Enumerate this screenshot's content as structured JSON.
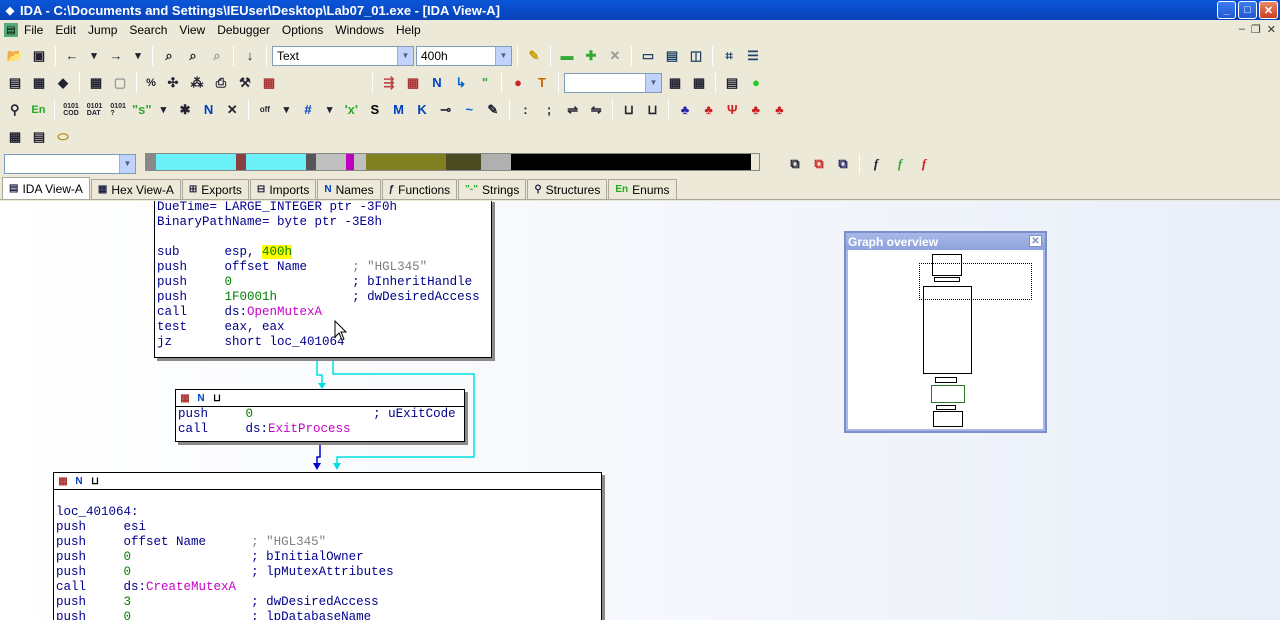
{
  "window": {
    "title": "IDA - C:\\Documents and Settings\\IEUser\\Desktop\\Lab07_01.exe - [IDA View-A]",
    "buttons": [
      "_",
      "□",
      "✕"
    ]
  },
  "menubar": {
    "items": [
      "File",
      "Edit",
      "Jump",
      "Search",
      "View",
      "Debugger",
      "Options",
      "Windows",
      "Help"
    ]
  },
  "toolbar": {
    "display_combo": "Text",
    "offset_combo": "400h",
    "segment_combo": "",
    "name_combo": ""
  },
  "tabs": [
    {
      "label": "IDA View-A",
      "icon": "disasm-icon",
      "active": true
    },
    {
      "label": "Hex View-A",
      "icon": "hex-icon",
      "active": false
    },
    {
      "label": "Exports",
      "icon": "exports-icon",
      "active": false
    },
    {
      "label": "Imports",
      "icon": "imports-icon",
      "active": false
    },
    {
      "label": "Names",
      "icon": "names-icon",
      "active": false
    },
    {
      "label": "Functions",
      "icon": "functions-icon",
      "active": false
    },
    {
      "label": "Strings",
      "icon": "strings-icon",
      "active": false
    },
    {
      "label": "Structures",
      "icon": "structures-icon",
      "active": false
    },
    {
      "label": "Enums",
      "icon": "enums-icon",
      "active": false
    }
  ],
  "graph": {
    "block1": {
      "lines": [
        {
          "a": "DueTime= LARGE_INTEGER ptr -3F0h"
        },
        {
          "a": "BinaryPathName= byte ptr -3E8h"
        },
        {
          "a": ""
        },
        {
          "m": "sub",
          "o": "esp, ",
          "h": "400h",
          "c": ""
        },
        {
          "m": "push",
          "o": "offset Name",
          "c": "; \"HGL345\"",
          "cg": true
        },
        {
          "m": "push",
          "n": "0",
          "c": "; bInheritHandle"
        },
        {
          "m": "push",
          "n": "1F0001h",
          "c": "; dwDesiredAccess"
        },
        {
          "m": "call",
          "o": "ds:",
          "i": "OpenMutexA"
        },
        {
          "m": "test",
          "o": "eax, eax"
        },
        {
          "m": "jz",
          "o": "short loc_401064"
        }
      ]
    },
    "block2": {
      "lines": [
        {
          "m": "push",
          "n": "0",
          "c": "; uExitCode"
        },
        {
          "m": "call",
          "o": "ds:",
          "i": "ExitProcess"
        }
      ]
    },
    "block3": {
      "label": "loc_401064:",
      "lines": [
        {
          "m": "push",
          "o": "esi"
        },
        {
          "m": "push",
          "o": "offset Name",
          "c": "; \"HGL345\"",
          "cg": true
        },
        {
          "m": "push",
          "n": "0",
          "c": "; bInitialOwner"
        },
        {
          "m": "push",
          "n": "0",
          "c": "; lpMutexAttributes"
        },
        {
          "m": "call",
          "o": "ds:",
          "i": "CreateMutexA"
        },
        {
          "m": "push",
          "n": "3",
          "c": "; dwDesiredAccess"
        },
        {
          "m": "push",
          "n": "0",
          "c": "; lpDatabaseName"
        }
      ]
    }
  },
  "overview": {
    "title": "Graph overview"
  },
  "colors": {
    "title_bar": "#0a56d8",
    "mnemonic": "#00008b",
    "number": "#008000",
    "import": "#c800c8",
    "highlight": "#ffff00",
    "edge_true": "#00e0e0",
    "edge_flow": "#0000cc"
  }
}
